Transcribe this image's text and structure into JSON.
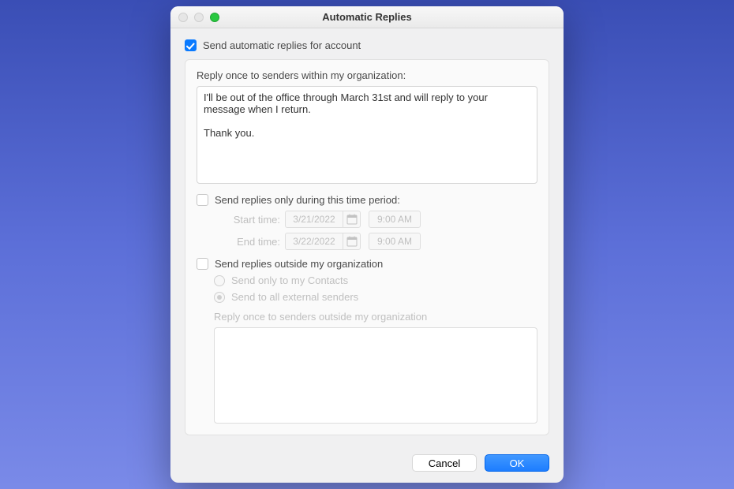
{
  "window": {
    "title": "Automatic Replies"
  },
  "main": {
    "send_automatic_label": "Send automatic replies for account",
    "send_automatic_checked": true,
    "internal_reply_label": "Reply once to senders within my organization:",
    "internal_reply_body": "I'll be out of the office through March 31st and will reply to your message when I return.\n\nThank you.",
    "time_period": {
      "checkbox_label": "Send replies only during this time period:",
      "checked": false,
      "start_label": "Start time:",
      "end_label": "End time:",
      "start_date": "3/21/2022",
      "start_time": "9:00 AM",
      "end_date": "3/22/2022",
      "end_time": "9:00 AM"
    },
    "external": {
      "checkbox_label": "Send replies outside my organization",
      "checked": false,
      "radio_contacts_label": "Send only to my Contacts",
      "radio_all_label": "Send to all external senders",
      "radio_selected": "all",
      "reply_label": "Reply once to senders outside my organization",
      "reply_body": ""
    }
  },
  "footer": {
    "cancel_label": "Cancel",
    "ok_label": "OK"
  }
}
